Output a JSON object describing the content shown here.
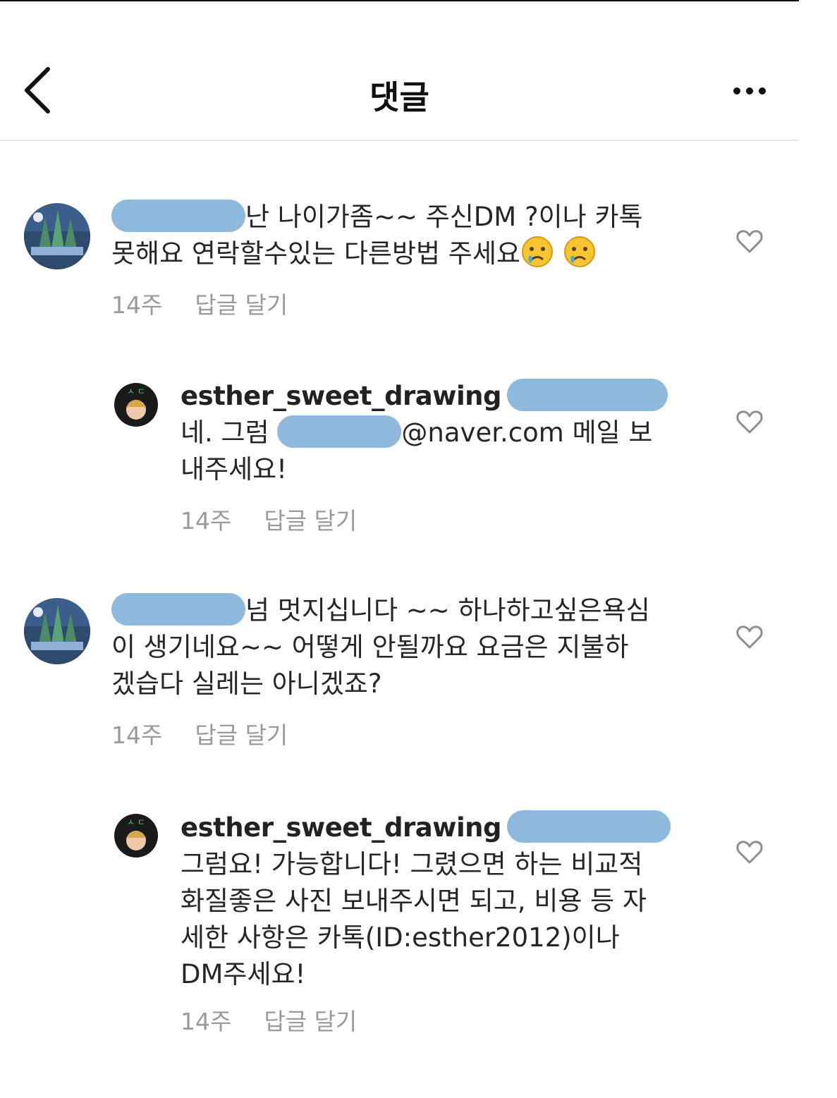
{
  "header": {
    "title": "댓글"
  },
  "comments": [
    {
      "line1": "난 나이가좀~~ 주신DM ?이나 카톡",
      "line2": "못해요  연락할수있는  다른방법 주세요",
      "time": "14주",
      "reply": "답글 달기"
    },
    {
      "username": "esther_sweet_drawing",
      "line1_prefix": "네. 그럼",
      "line1_suffix": "@naver.com 메일 보",
      "line2": "내주세요!",
      "time": "14주",
      "reply": "답글 달기"
    },
    {
      "line1": "넘  멋지십니다 ~~ 하나하고싶은욕심",
      "line2": "이 생기네요~~ 어떻게 안될까요 요금은 지불하",
      "line3": "겠습다  실레는 아니겠죠?",
      "time": "14주",
      "reply": "답글 달기"
    },
    {
      "username": "esther_sweet_drawing",
      "line1": "그럼요! 가능합니다! 그렸으면 하는 비교적",
      "line2": "화질좋은 사진 보내주시면 되고, 비용 등 자",
      "line3": "세한 사항은 카톡(ID:esther2012)이나",
      "line4": "DM주세요!",
      "time": "14주",
      "reply": "답글 달기"
    }
  ],
  "icons": [
    "back-arrow-icon",
    "more-options-icon",
    "heart-icon",
    "crying-face-emoji"
  ],
  "colors": {
    "redaction": "#8fb8dd",
    "meta_text": "#9a9a9a",
    "text": "#262626"
  }
}
